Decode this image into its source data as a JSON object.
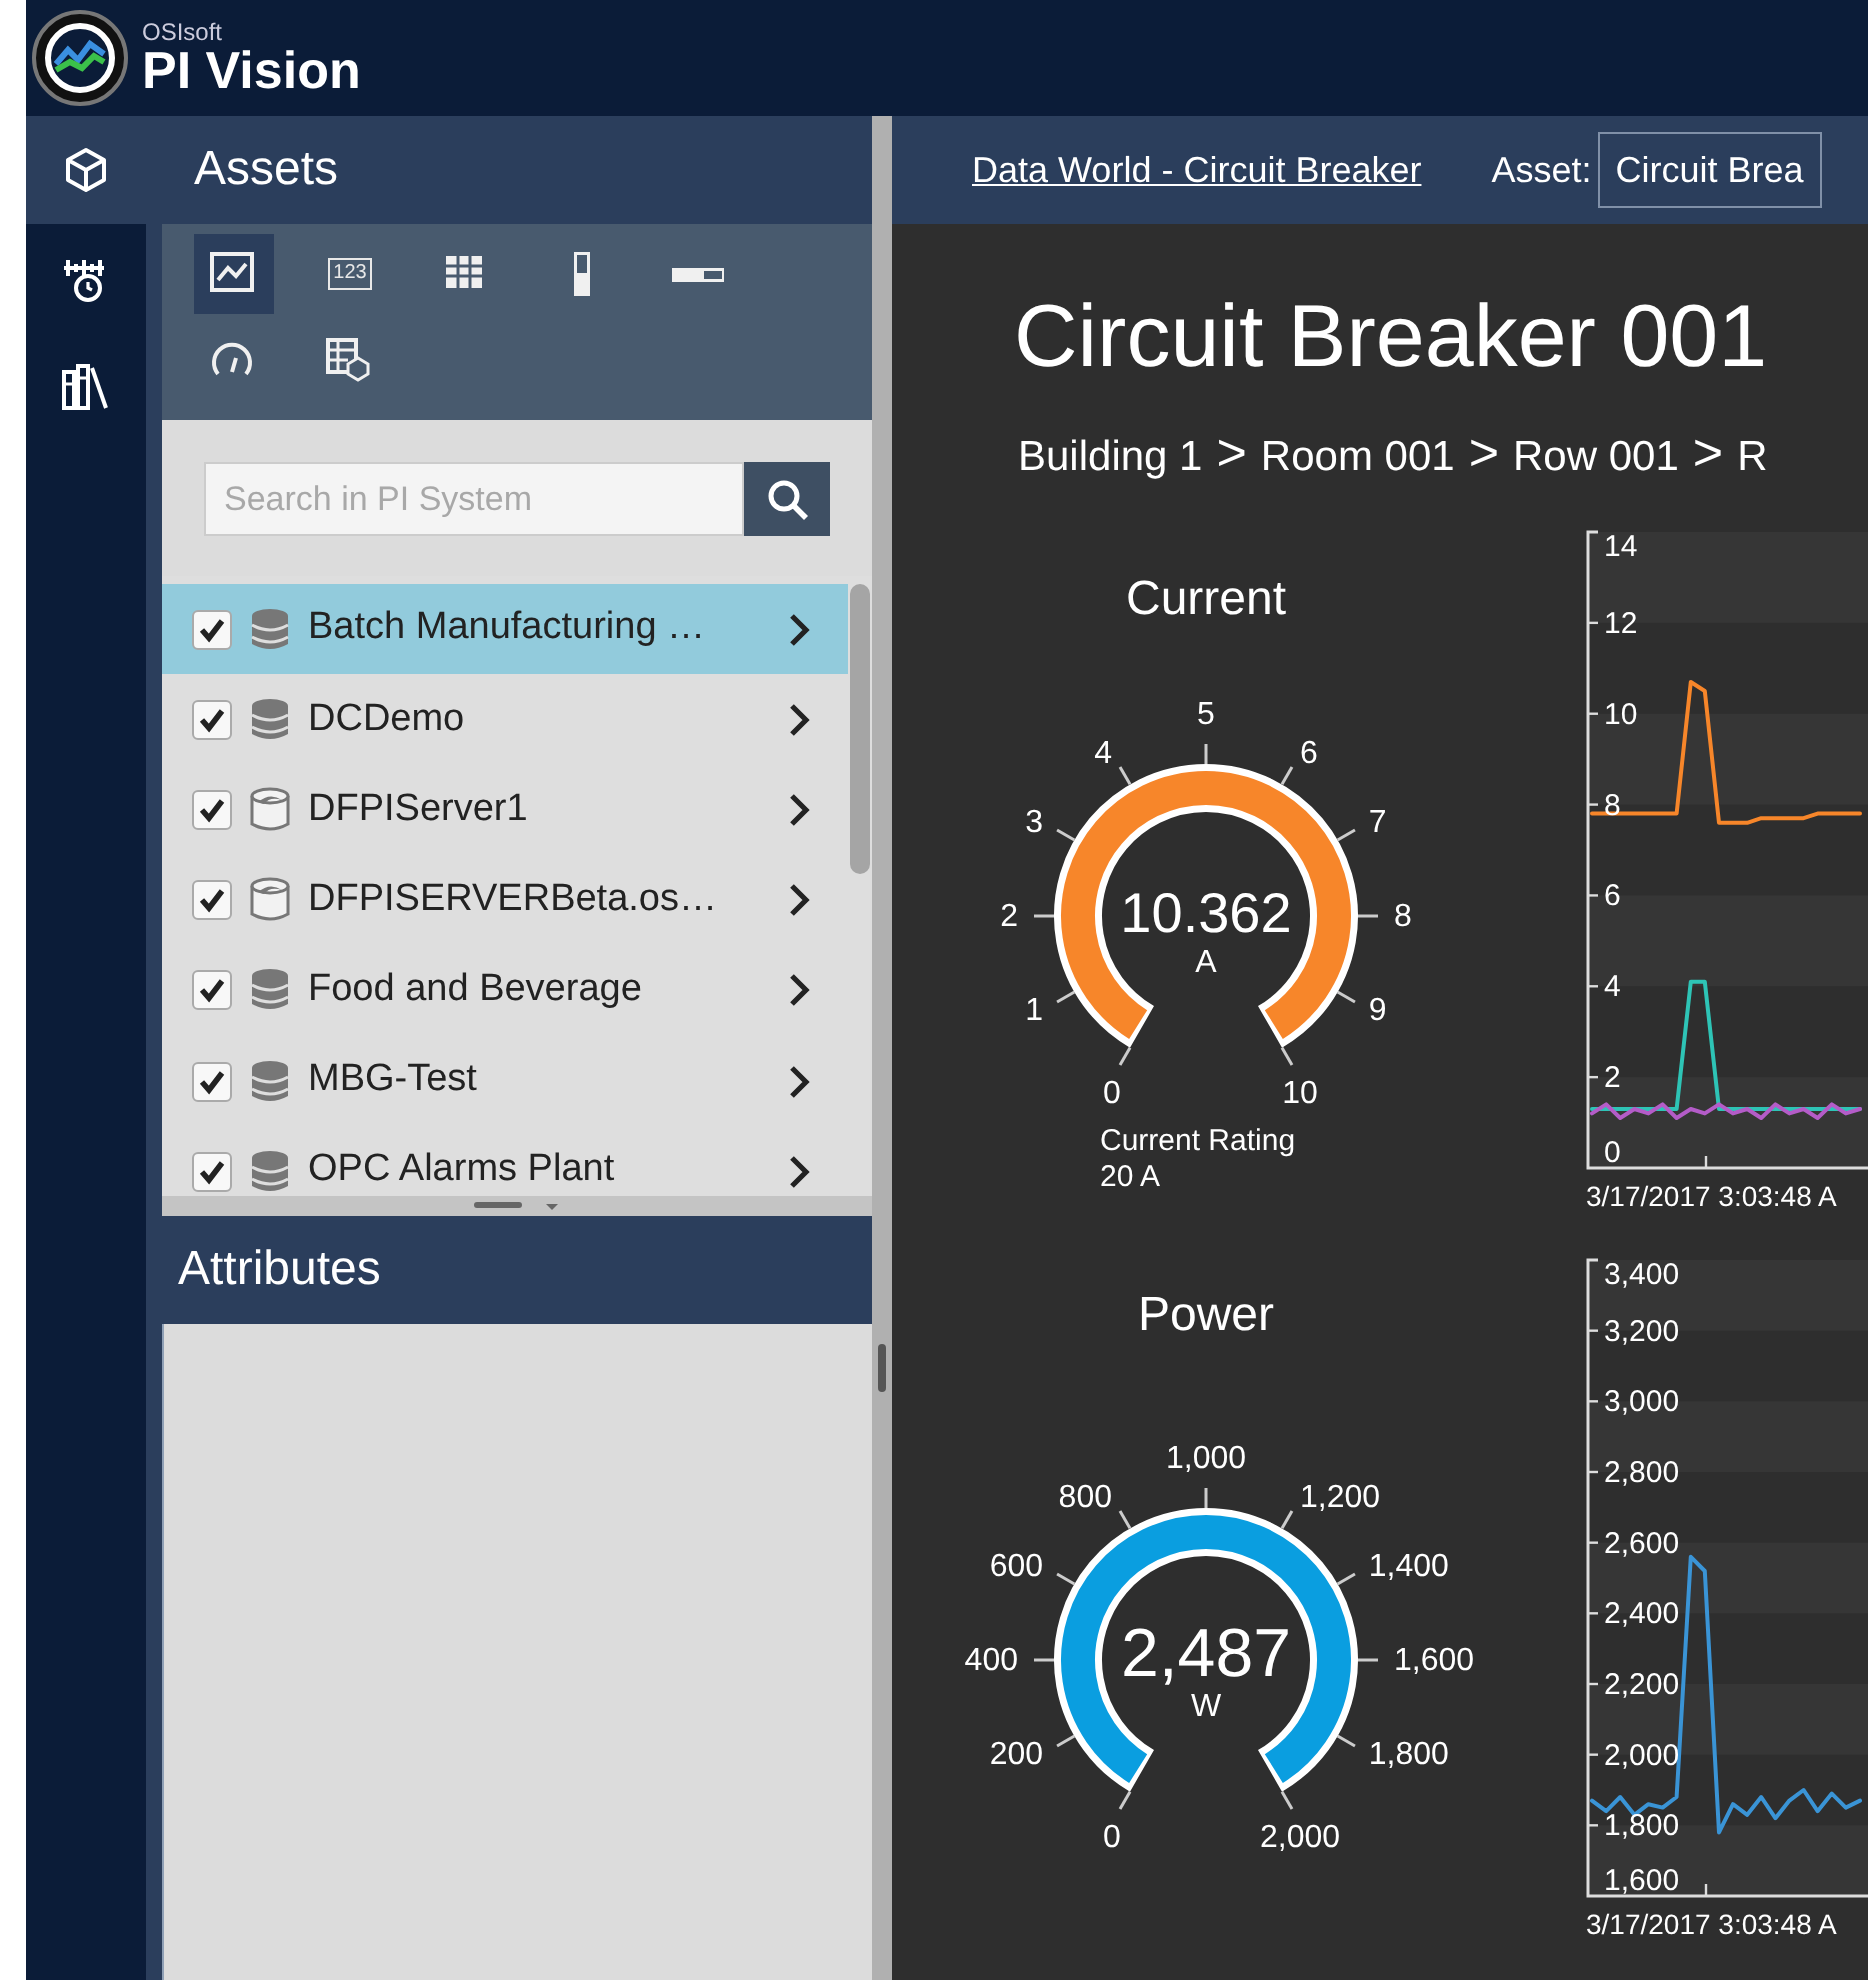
{
  "header": {
    "brand": "OSIsoft",
    "product": "PI Vision"
  },
  "nav_rail": [
    {
      "kind": "assets",
      "selected": true
    },
    {
      "kind": "events",
      "selected": false
    },
    {
      "kind": "library",
      "selected": false
    }
  ],
  "assets_panel": {
    "title": "Assets",
    "tools": [
      {
        "kind": "trend",
        "selected": true
      },
      {
        "kind": "value",
        "label": "123",
        "selected": false
      },
      {
        "kind": "table",
        "selected": false
      },
      {
        "kind": "vertical-gauge",
        "selected": false
      },
      {
        "kind": "horizontal-gauge",
        "selected": false
      },
      {
        "kind": "radial-gauge",
        "selected": false
      },
      {
        "kind": "asset-table",
        "selected": false
      }
    ],
    "search": {
      "placeholder": "Search in PI System"
    },
    "items": [
      {
        "name": "Batch Manufacturing …",
        "kind": "database",
        "checked": true,
        "selected": true
      },
      {
        "name": "DCDemo",
        "kind": "database",
        "checked": true,
        "selected": false
      },
      {
        "name": "DFPIServer1",
        "kind": "server",
        "checked": true,
        "selected": false
      },
      {
        "name": "DFPISERVERBeta.os…",
        "kind": "server",
        "checked": true,
        "selected": false
      },
      {
        "name": "Food and Beverage",
        "kind": "database",
        "checked": true,
        "selected": false
      },
      {
        "name": "MBG-Test",
        "kind": "database",
        "checked": true,
        "selected": false
      },
      {
        "name": "OPC Alarms Plant",
        "kind": "database",
        "checked": true,
        "selected": false
      }
    ]
  },
  "attributes_panel": {
    "title": "Attributes"
  },
  "display_bar": {
    "display_name": "Data World - Circuit Breaker",
    "asset_label": "Asset:",
    "asset_value": "Circuit Brea"
  },
  "dashboard": {
    "title": "Circuit Breaker 001",
    "breadcrumb": [
      {
        "label": "Building 1",
        "separator": ">"
      },
      {
        "label": "Room 001",
        "separator": ">"
      },
      {
        "label": "Row 001",
        "separator": ">"
      },
      {
        "label": "R"
      }
    ],
    "rows": [
      {
        "gauge": {
          "title": "Current",
          "value": "10.362",
          "unit": "A",
          "level": 1,
          "color": "#f7862a",
          "ticks": [
            "0",
            "1",
            "2",
            "3",
            "4",
            "5",
            "6",
            "7",
            "8",
            "9",
            "10"
          ],
          "caption": [
            "Current Rating",
            "20 A"
          ]
        },
        "trend": {
          "x_start_label": "3/17/2017 3:03:48 A",
          "chart_data": {
            "type": "line",
            "ylim": [
              0,
              14
            ],
            "yticks": [
              0,
              2,
              4,
              6,
              8,
              10,
              12,
              14
            ],
            "series": [
              {
                "color": "#f7862a",
                "values": [
                  7.8,
                  7.8,
                  7.8,
                  7.8,
                  7.8,
                  7.8,
                  7.8,
                  10.7,
                  10.5,
                  7.6,
                  7.6,
                  7.6,
                  7.7,
                  7.7,
                  7.7,
                  7.7,
                  7.8,
                  7.8,
                  7.8,
                  7.8
                ]
              },
              {
                "color": "#2ec4b6",
                "values": [
                  1.3,
                  1.3,
                  1.3,
                  1.3,
                  1.3,
                  1.3,
                  1.3,
                  4.1,
                  4.1,
                  1.3,
                  1.3,
                  1.3,
                  1.3,
                  1.3,
                  1.3,
                  1.3,
                  1.3,
                  1.3,
                  1.3,
                  1.3
                ]
              },
              {
                "color": "#b45cc8",
                "values": [
                  1.2,
                  1.4,
                  1.1,
                  1.3,
                  1.2,
                  1.4,
                  1.1,
                  1.3,
                  1.2,
                  1.4,
                  1.2,
                  1.3,
                  1.1,
                  1.4,
                  1.2,
                  1.3,
                  1.1,
                  1.4,
                  1.2,
                  1.3
                ]
              }
            ]
          }
        }
      },
      {
        "gauge": {
          "title": "Power",
          "value": "2,487",
          "unit": "W",
          "level": 1,
          "color": "#0a9ee0",
          "ticks": [
            "0",
            "200",
            "400",
            "600",
            "800",
            "1,000",
            "1,200",
            "1,400",
            "1,600",
            "1,800",
            "2,000"
          ]
        },
        "trend": {
          "x_start_label": "3/17/2017 3:03:48 A",
          "chart_data": {
            "type": "line",
            "ylim": [
              1600,
              3400
            ],
            "yticks": [
              {
                "value": 1600,
                "label": "1,600"
              },
              {
                "value": 1800,
                "label": "1,800"
              },
              {
                "value": 2000,
                "label": "2,000"
              },
              {
                "value": 2200,
                "label": "2,200"
              },
              {
                "value": 2400,
                "label": "2,400"
              },
              {
                "value": 2600,
                "label": "2,600"
              },
              {
                "value": 2800,
                "label": "2,800"
              },
              {
                "value": 3000,
                "label": "3,000"
              },
              {
                "value": 3200,
                "label": "3,200"
              },
              {
                "value": 3400,
                "label": "3,400"
              }
            ],
            "series": [
              {
                "color": "#3a94d6",
                "values": [
                  1870,
                  1840,
                  1880,
                  1830,
                  1860,
                  1850,
                  1880,
                  2560,
                  2520,
                  1780,
                  1860,
                  1830,
                  1880,
                  1820,
                  1870,
                  1900,
                  1840,
                  1890,
                  1850,
                  1870
                ]
              }
            ]
          }
        }
      }
    ]
  }
}
